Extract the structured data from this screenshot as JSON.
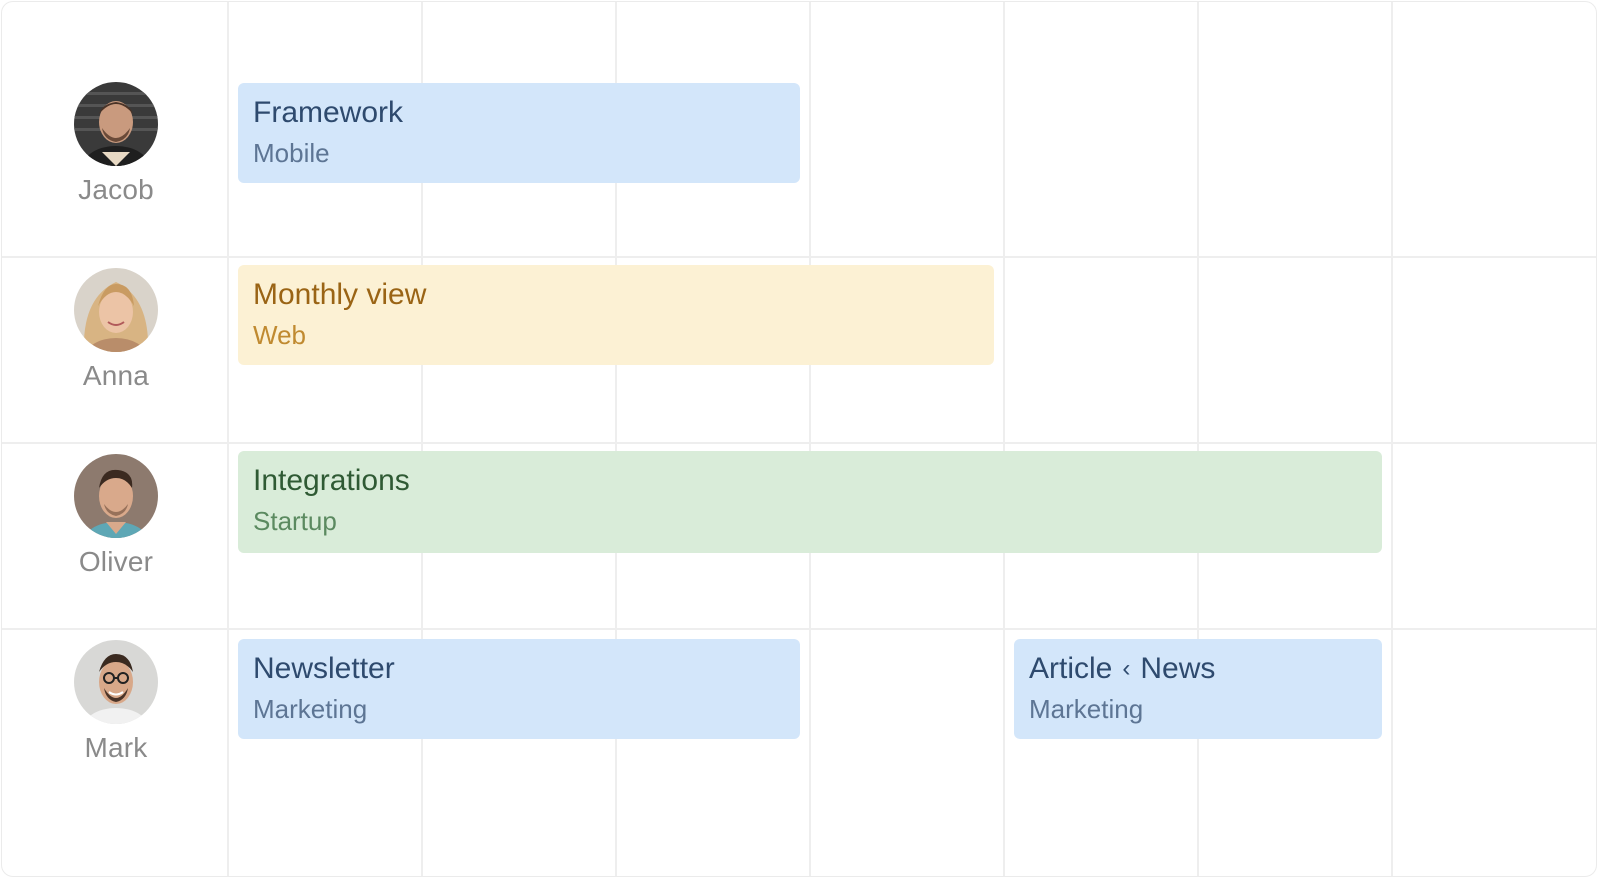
{
  "people": [
    {
      "name": "Jacob",
      "avatar_icon": "avatar-jacob-icon"
    },
    {
      "name": "Anna",
      "avatar_icon": "avatar-anna-icon"
    },
    {
      "name": "Oliver",
      "avatar_icon": "avatar-oliver-icon"
    },
    {
      "name": "Mark",
      "avatar_icon": "avatar-mark-icon"
    }
  ],
  "events": [
    {
      "title": "Framework",
      "subtitle": "Mobile",
      "color": "#d3e6fa"
    },
    {
      "title": "Monthly view",
      "subtitle": "Web",
      "color": "#fcf1d4"
    },
    {
      "title": "Integrations",
      "subtitle": "Startup",
      "color": "#d9ecd9"
    },
    {
      "title": "Newsletter",
      "subtitle": "Marketing",
      "color": "#d3e6fa"
    },
    {
      "title_part1": "Article",
      "separator": "‹",
      "title_part2": "News",
      "subtitle": "Marketing",
      "color": "#d3e6fa"
    }
  ],
  "colors": {
    "blue": "#d3e6fa",
    "yellow": "#fcf1d4",
    "green": "#d9ecd9",
    "gridline": "#eeeeee"
  }
}
